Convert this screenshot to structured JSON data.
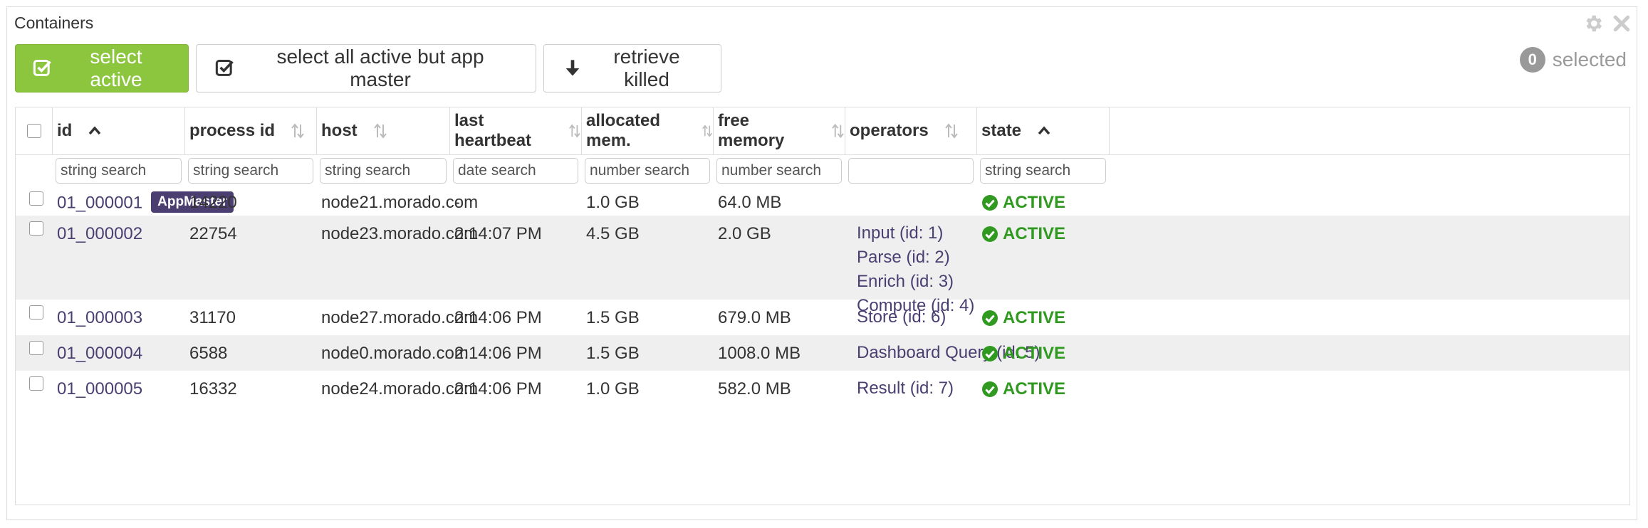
{
  "panel": {
    "title": "Containers",
    "tools": [
      "gear-icon",
      "close-icon"
    ]
  },
  "toolbar": {
    "select_active": "select active",
    "select_all_but_master": "select all active but app master",
    "retrieve_killed": "retrieve killed",
    "selected_count": "0",
    "selected_label": "selected"
  },
  "colors": {
    "primary_button": "#8cc63f",
    "link": "#4b3f72",
    "active_state": "#2f9a1f",
    "row_alt": "#efefef"
  },
  "table": {
    "columns": [
      {
        "label": "id",
        "sort": "asc",
        "filter_placeholder": "string search"
      },
      {
        "label": "process id",
        "sort": "none",
        "filter_placeholder": "string search"
      },
      {
        "label": "host",
        "sort": "none",
        "filter_placeholder": "string search"
      },
      {
        "label": "last heartbeat",
        "sort": "none",
        "filter_placeholder": "date search"
      },
      {
        "label": "allocated mem.",
        "sort": "none",
        "filter_placeholder": "number search"
      },
      {
        "label": "free memory",
        "sort": "none",
        "filter_placeholder": "number search"
      },
      {
        "label": "operators",
        "sort": "none",
        "filter_placeholder": ""
      },
      {
        "label": "state",
        "sort": "asc",
        "filter_placeholder": "string search"
      }
    ],
    "rows": [
      {
        "id": "01_000001",
        "badge": "AppMaster",
        "process_id": "14220",
        "host": "node21.morado.com",
        "last_heartbeat": "-",
        "allocated_mem": "1.0 GB",
        "free_memory": "64.0 MB",
        "operators": [],
        "state": "ACTIVE"
      },
      {
        "id": "01_000002",
        "badge": "",
        "process_id": "22754",
        "host": "node23.morado.com",
        "last_heartbeat": "2:14:07 PM",
        "allocated_mem": "4.5 GB",
        "free_memory": "2.0 GB",
        "operators": [
          "Input (id: 1)",
          "Parse (id: 2)",
          "Enrich (id: 3)",
          "Compute (id: 4)"
        ],
        "state": "ACTIVE"
      },
      {
        "id": "01_000003",
        "badge": "",
        "process_id": "31170",
        "host": "node27.morado.com",
        "last_heartbeat": "2:14:06 PM",
        "allocated_mem": "1.5 GB",
        "free_memory": "679.0 MB",
        "operators": [
          "Store (id: 6)"
        ],
        "state": "ACTIVE"
      },
      {
        "id": "01_000004",
        "badge": "",
        "process_id": "6588",
        "host": "node0.morado.com",
        "last_heartbeat": "2:14:06 PM",
        "allocated_mem": "1.5 GB",
        "free_memory": "1008.0 MB",
        "operators": [
          "Dashboard Query (id: 5)"
        ],
        "state": "ACTIVE"
      },
      {
        "id": "01_000005",
        "badge": "",
        "process_id": "16332",
        "host": "node24.morado.com",
        "last_heartbeat": "2:14:06 PM",
        "allocated_mem": "1.0 GB",
        "free_memory": "582.0 MB",
        "operators": [
          "Result (id: 7)"
        ],
        "state": "ACTIVE"
      }
    ]
  }
}
